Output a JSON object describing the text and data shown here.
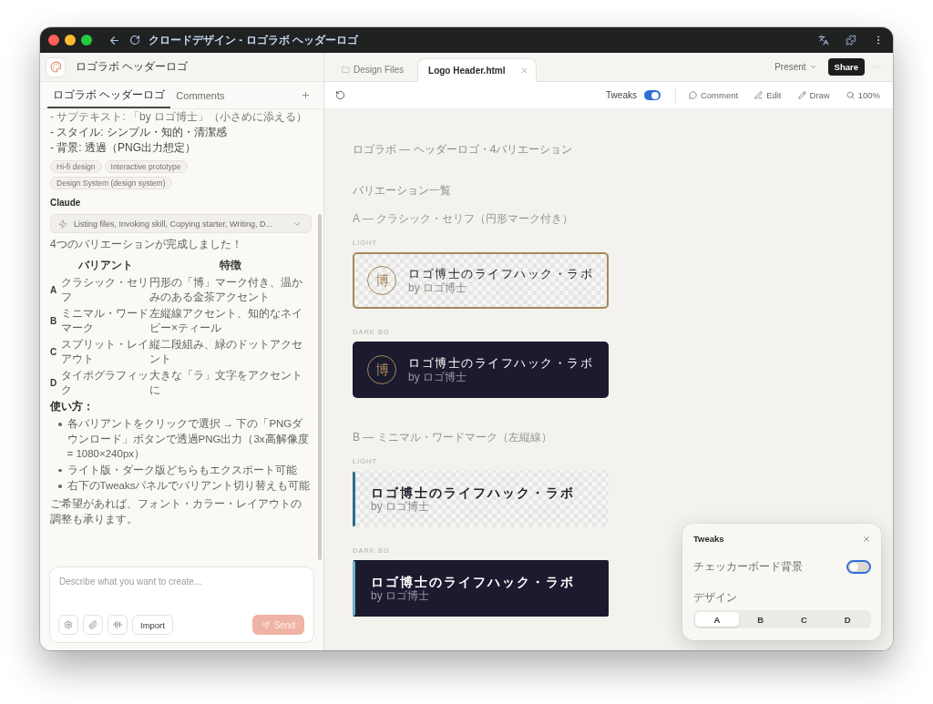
{
  "window": {
    "title": "クロードデザイン - ロゴラボ ヘッダーロゴ"
  },
  "project": {
    "title": "ロゴラボ ヘッダーロゴ"
  },
  "chat_tabs": [
    {
      "label": "ロゴラボ ヘッダーロゴ",
      "selected": true
    },
    {
      "label": "Comments",
      "selected": false
    }
  ],
  "chat": {
    "brief_lines": [
      "- サブテキスト: 「by ロゴ博士」（小さめに添える）",
      "- スタイル: シンプル・知的・清潔感",
      "- 背景: 透過（PNG出力想定）"
    ],
    "tags": [
      "Hi-fi design",
      "Interactive prototype",
      "Design System (design system)"
    ],
    "author": "Claude",
    "tool_summary": {
      "text": "Listing files, Invoking skill, Copying starter, Writing, D...",
      "expanded": false
    },
    "intro": "4つのバリエーションが完成しました！",
    "table": {
      "columns": [
        "バリアント",
        "特徴"
      ],
      "rows": [
        {
          "variant": "A",
          "name": "クラシック・セリフ",
          "feature": "円形の「博」マーク付き、温かみのある金茶アクセント"
        },
        {
          "variant": "B",
          "name": "ミニマル・ワードマーク",
          "feature": "左縦線アクセント、知的なネイビー×ティール"
        },
        {
          "variant": "C",
          "name": "スプリット・レイアウト",
          "feature": "縦二段組み、緑のドットアクセント"
        },
        {
          "variant": "D",
          "name": "タイポグラフィック",
          "feature": "大きな「ラ」文字をアクセントに"
        }
      ]
    },
    "usage_heading": "使い方：",
    "usage_items": [
      "各バリアントをクリックで選択 → 下の「PNGダウンロード」ボタンで透過PNG出力（3x高解像度 = 1080×240px）",
      "ライト版・ダーク版どちらもエクスポート可能",
      "右下のTweaksパネルでバリアント切り替えも可能"
    ],
    "closing": "ご希望があれば、フォント・カラー・レイアウトの調整も承ります。"
  },
  "composer": {
    "placeholder": "Describe what you want to create...",
    "import_label": "Import",
    "send_label": "Send",
    "send_disabled": true
  },
  "file_tabs": [
    {
      "label": "Design Files",
      "kind": "folder",
      "selected": false
    },
    {
      "label": "Logo Header.html",
      "kind": "file",
      "selected": true
    }
  ],
  "header_actions": {
    "present": "Present",
    "share": "Share"
  },
  "toolbar": {
    "tweaks_label": "Tweaks",
    "tweaks_on": true,
    "tools": [
      {
        "kind": "comment",
        "label": "Comment"
      },
      {
        "kind": "edit",
        "label": "Edit"
      },
      {
        "kind": "draw",
        "label": "Draw"
      },
      {
        "kind": "zoom",
        "label": "100%"
      }
    ]
  },
  "canvas": {
    "title": "ロゴラボ — ヘッダーロゴ・4バリエーション",
    "section_title": "バリエーション一覧",
    "variants": [
      {
        "kind": "classic",
        "heading": "A — クラシック・セリフ（円形マーク付き）",
        "previews": [
          {
            "label": "LIGHT",
            "dark": false,
            "selected": true,
            "mark": "博",
            "name": "ロゴ博士のライフハック・ラボ",
            "byline": "by ロゴ博士"
          },
          {
            "label": "DARK BG",
            "dark": true,
            "selected": false,
            "mark": "博",
            "name": "ロゴ博士のライフハック・ラボ",
            "byline": "by ロゴ博士"
          }
        ]
      },
      {
        "kind": "minimal",
        "heading": "B — ミニマル・ワードマーク（左縦線）",
        "previews": [
          {
            "label": "LIGHT",
            "dark": false,
            "selected": false,
            "name": "ロゴ博士のライフハック・ラボ",
            "byline": "by ロゴ博士"
          },
          {
            "label": "DARK BG",
            "dark": true,
            "selected": false,
            "name": "ロゴ博士のライフハック・ラボ",
            "byline": "by ロゴ博士"
          }
        ]
      }
    ]
  },
  "tweaks_panel": {
    "title": "Tweaks",
    "checkerboard_label": "チェッカーボード背景",
    "checkerboard_on": false,
    "design_label": "デザイン",
    "design_options": [
      {
        "label": "A",
        "selected": true
      },
      {
        "label": "B",
        "selected": false
      },
      {
        "label": "C",
        "selected": false
      },
      {
        "label": "D",
        "selected": false
      }
    ]
  }
}
